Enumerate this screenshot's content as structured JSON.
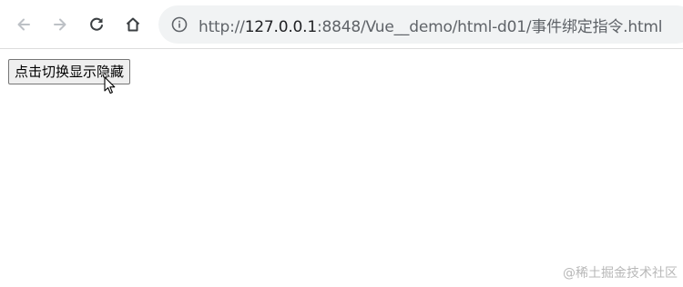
{
  "browser": {
    "back_icon": "arrow-left-icon",
    "forward_icon": "arrow-right-icon",
    "reload_icon": "reload-icon",
    "home_icon": "home-icon",
    "info_icon": "info-icon",
    "url_scheme": "http://",
    "url_host": "127.0.0.1",
    "url_rest": ":8848/Vue__demo/html-d01/事件绑定指令.html"
  },
  "page": {
    "toggle_button_label": "点击切换显示隐藏"
  },
  "watermark": "@稀土掘金技术社区",
  "colors": {
    "omnibox_bg": "#f1f3f4",
    "icon_active": "#3c4043",
    "icon_disabled": "#bdc1c6"
  }
}
